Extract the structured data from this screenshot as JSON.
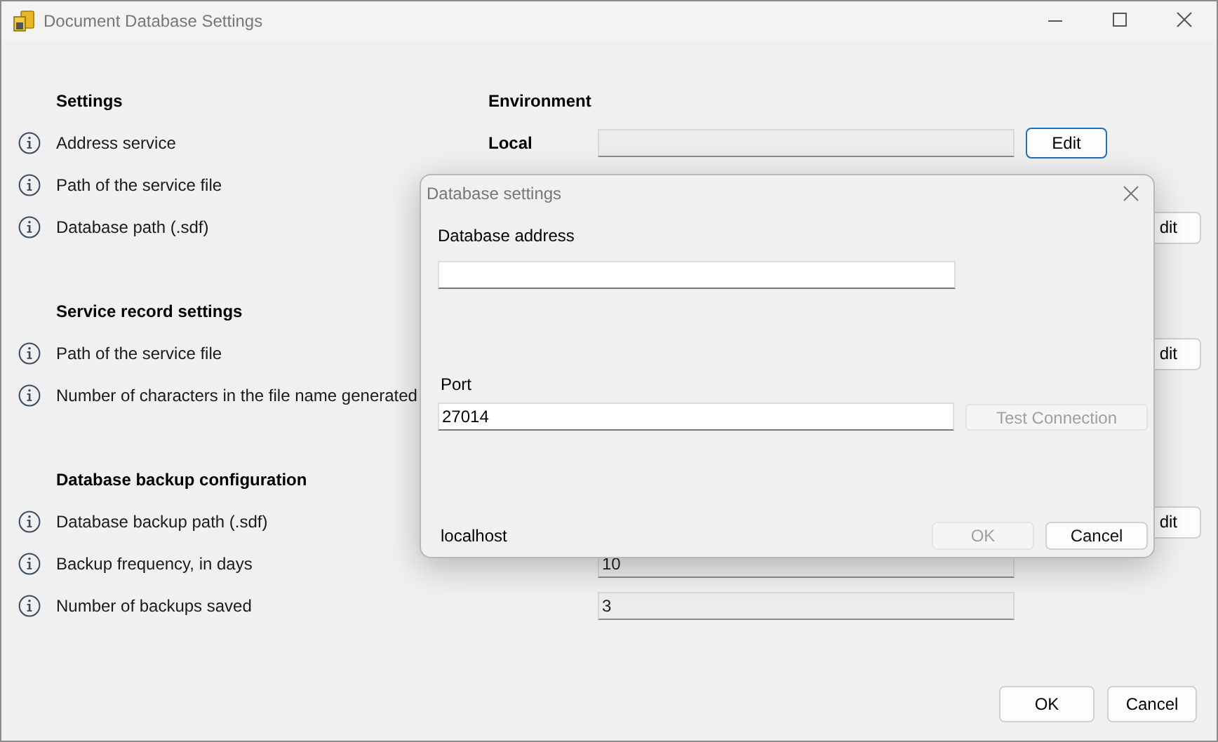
{
  "window": {
    "title": "Document Database Settings"
  },
  "sections": [
    {
      "heading": "Settings",
      "column_heading": "Environment",
      "rows": [
        {
          "label": "Address service",
          "kind": "field_button",
          "environment": "Local",
          "button": "Edit"
        },
        {
          "label": "Path of the service file",
          "kind": "text"
        },
        {
          "label": "Database path (.sdf)",
          "kind": "button",
          "button": "dit"
        }
      ]
    },
    {
      "heading": "Service record settings",
      "rows": [
        {
          "label": "Path of the service file",
          "kind": "button",
          "button": "dit"
        },
        {
          "label": "Number of characters in the file name generated",
          "kind": "text"
        }
      ]
    },
    {
      "heading": "Database backup configuration",
      "rows": [
        {
          "label": "Database backup path (.sdf)",
          "kind": "button",
          "button": "dit"
        },
        {
          "label": "Backup frequency, in days",
          "kind": "field",
          "value": "10"
        },
        {
          "label": "Number of backups saved",
          "kind": "field",
          "value": "3"
        }
      ]
    }
  ],
  "footer_buttons": [
    "OK",
    "Cancel"
  ],
  "dialog": {
    "title": "Database settings",
    "address": {
      "label": "Database address"
    },
    "port": {
      "label": "Port",
      "value": "27014"
    },
    "test_button": {
      "label": "Test Connection",
      "disabled": true
    },
    "status": "localhost",
    "buttons": [
      {
        "label": "OK",
        "disabled": true
      },
      {
        "label": "Cancel",
        "disabled": false
      }
    ]
  }
}
